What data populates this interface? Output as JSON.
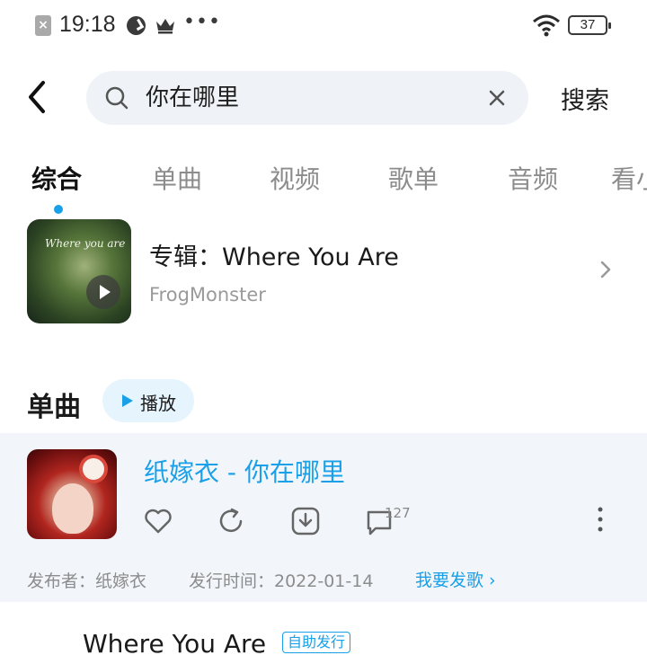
{
  "status_bar": {
    "time": "19:18",
    "notification_icon": "x-icon",
    "battery": "37"
  },
  "search": {
    "query": "你在哪里",
    "submit_label": "搜索"
  },
  "tabs": [
    {
      "label": "综合",
      "active": true
    },
    {
      "label": "单曲",
      "active": false
    },
    {
      "label": "视频",
      "active": false
    },
    {
      "label": "歌单",
      "active": false
    },
    {
      "label": "音频",
      "active": false
    },
    {
      "label": "看小",
      "active": false
    }
  ],
  "album_card": {
    "title": "专辑：Where You Are",
    "artist": "FrogMonster",
    "cover_text": "Where you are"
  },
  "singles_section": {
    "title": "单曲",
    "play_all_label": "播放"
  },
  "song": {
    "title": "纸嫁衣 - 你在哪里",
    "comment_count": "127",
    "publisher": "发布者：纸嫁衣",
    "release_date": "发行时间：2022-01-14",
    "release_link": "我要发歌 ›"
  },
  "next_song": {
    "title": "Where You Are",
    "badge": "自助发行"
  },
  "colors": {
    "accent": "#1aa0e8",
    "search_bg": "#eff2f6",
    "song_card_bg": "#f2f6fa"
  }
}
